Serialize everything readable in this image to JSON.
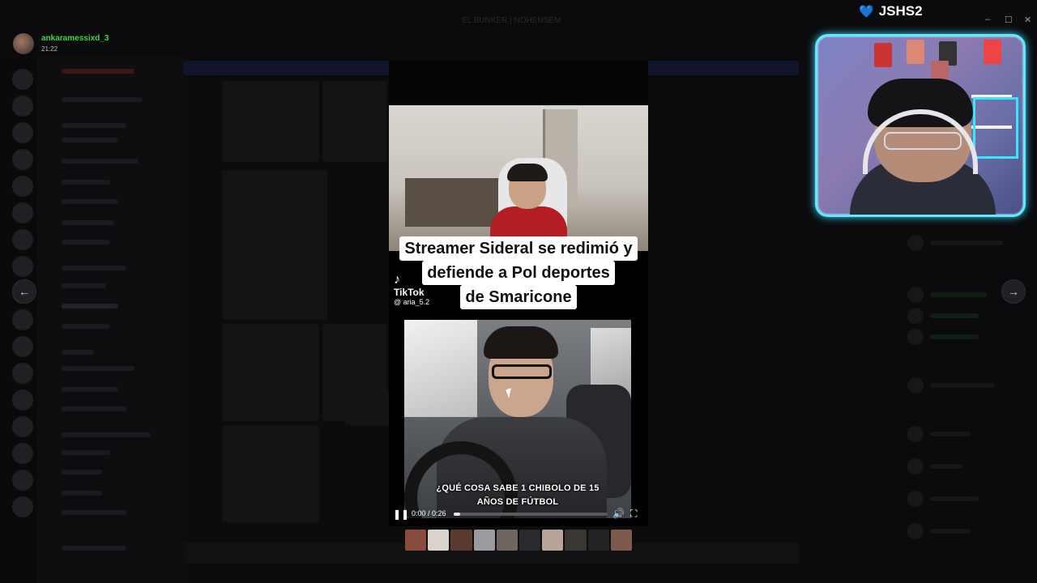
{
  "window": {
    "title": "EL BUNKER | NOHENSEM",
    "controls": {
      "minimize": "–",
      "maximize": "☐",
      "close": "✕"
    }
  },
  "user": {
    "name": "ankaramessixd_3",
    "time": "21:22"
  },
  "nav": {
    "prev_icon": "arrow-left-icon",
    "next_icon": "arrow-right-icon",
    "prev": "←",
    "next": "→"
  },
  "video": {
    "caption_lines": [
      "Streamer Sideral se redimió y",
      "defiende a Pol deportes",
      "de Smaricone"
    ],
    "tiktok": {
      "note": "♪",
      "name": "TikTok",
      "handle": "@ aria_5.2"
    },
    "subtitle_lines": [
      "¿QUÉ COSA SABE 1 CHIBOLO DE 15",
      "AÑOS DE FÚTBOL"
    ],
    "time": "0:00 / 0:26",
    "progress": 0.04,
    "play_icon": "pause-icon",
    "play_glyph": "❚❚",
    "volume_glyph": "🔊",
    "fullscreen_glyph": "⛶"
  },
  "overlay": {
    "channel_label": "JSHS2",
    "heart": "💙"
  }
}
